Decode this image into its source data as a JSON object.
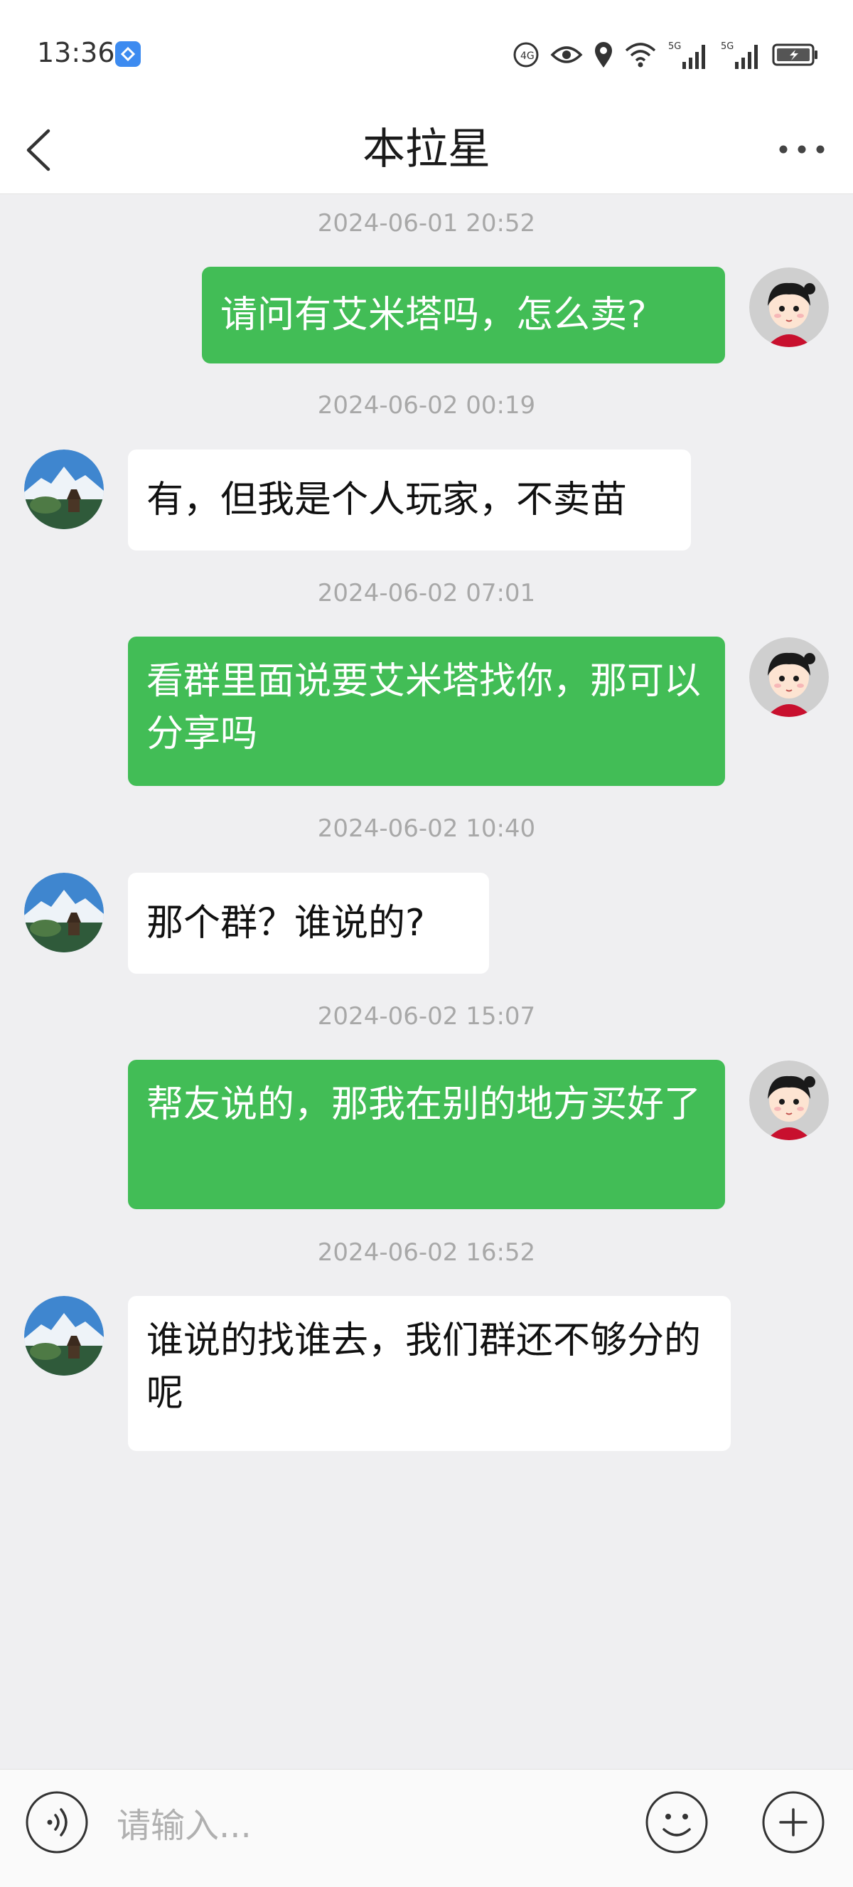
{
  "status_bar": {
    "time": "13:36",
    "icons": [
      "hd-icon",
      "eye-icon",
      "location-icon",
      "wifi-icon",
      "signal-5g-icon",
      "signal-5g-icon",
      "battery-icon"
    ],
    "network_label": "5G"
  },
  "header": {
    "title": "本拉星",
    "back_icon": "chevron-left-icon",
    "more_icon": "more-dots-icon"
  },
  "messages": [
    {
      "timestamp": "2024-06-01 20:52",
      "sender": "me",
      "text": "请问有艾米塔吗，怎么卖?"
    },
    {
      "timestamp": "2024-06-02 00:19",
      "sender": "other",
      "text": "有，但我是个人玩家，不卖苗"
    },
    {
      "timestamp": "2024-06-02 07:01",
      "sender": "me",
      "text": "看群里面说要艾米塔找你，那可以分享吗"
    },
    {
      "timestamp": "2024-06-02 10:40",
      "sender": "other",
      "text": "那个群？谁说的?"
    },
    {
      "timestamp": "2024-06-02 15:07",
      "sender": "me",
      "text": "帮友说的，那我在别的地方买好了"
    },
    {
      "timestamp": "2024-06-02 16:52",
      "sender": "other",
      "text": "谁说的找谁去，我们群还不够分的呢"
    }
  ],
  "input_bar": {
    "placeholder": "请输入...",
    "voice_icon": "voice-icon",
    "emoji_icon": "emoji-icon",
    "plus_icon": "plus-icon"
  },
  "colors": {
    "my_bubble": "#42bd56",
    "other_bubble": "#ffffff",
    "background": "#efeff1",
    "timestamp": "#a8a8a8"
  }
}
